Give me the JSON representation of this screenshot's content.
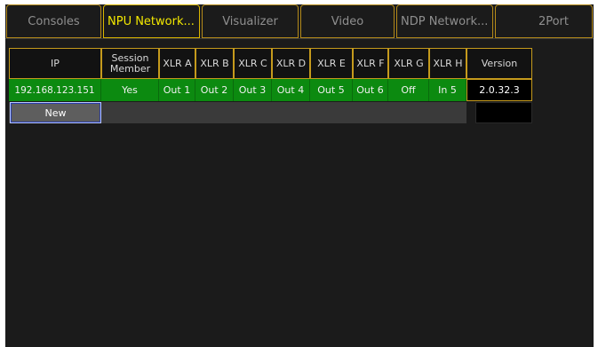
{
  "tabs": [
    {
      "label": "Consoles"
    },
    {
      "label": "NPU Network..."
    },
    {
      "label": "Visualizer"
    },
    {
      "label": "Video"
    },
    {
      "label": "NDP Network..."
    },
    {
      "label": "2Port"
    }
  ],
  "table": {
    "headers": [
      "IP",
      "Session\nMember",
      "XLR A",
      "XLR B",
      "XLR C",
      "XLR D",
      "XLR E",
      "XLR F",
      "XLR G",
      "XLR H",
      "Version"
    ],
    "rows": [
      [
        "192.168.123.151",
        "Yes",
        "Out 1",
        "Out 2",
        "Out 3",
        "Out 4",
        "Out 5",
        "Out 6",
        "Off",
        "In 5",
        "2.0.32.3"
      ]
    ],
    "new_button_label": "New"
  },
  "colors": {
    "active_tab_text": "#f4e900",
    "tab_border": "#b48a1a",
    "row_green": "#0c8a10",
    "background": "#1b1b1b"
  }
}
